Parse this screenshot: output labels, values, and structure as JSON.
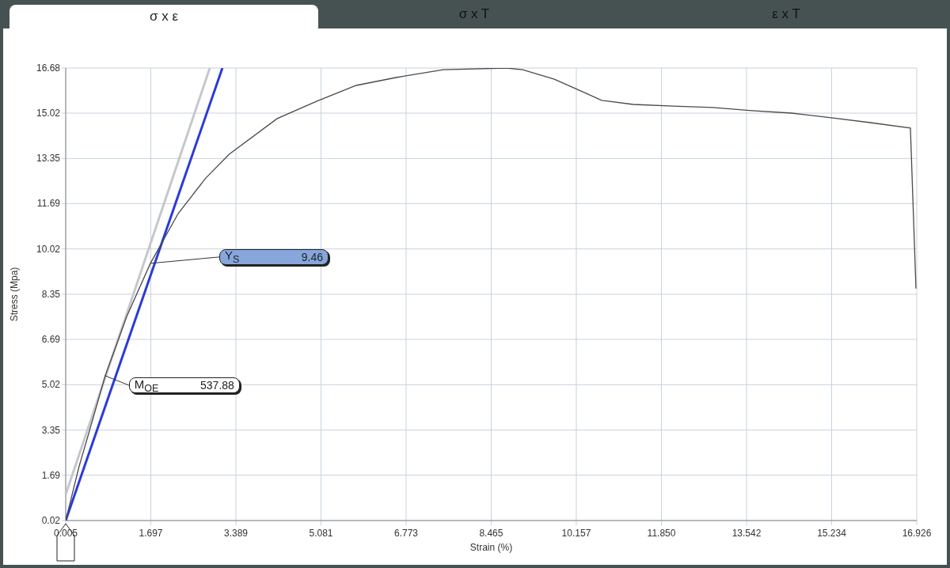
{
  "tabs": [
    {
      "label": "σ x ε",
      "selected": true
    },
    {
      "label": "σ x T",
      "selected": false
    },
    {
      "label": "ε x T",
      "selected": false
    }
  ],
  "chart": {
    "chart_data": {
      "type": "line",
      "xlabel": "Strain (%)",
      "ylabel": "Stress (Mpa)",
      "xlim": [
        0.005,
        16.926
      ],
      "ylim": [
        0.02,
        16.68
      ],
      "xticks": [
        0.005,
        1.697,
        3.389,
        5.081,
        6.773,
        8.465,
        10.157,
        {
          "value": 11.85,
          "label": "11.850"
        },
        13.542,
        15.234,
        16.926
      ],
      "yticks": [
        0.02,
        1.69,
        3.35,
        5.02,
        6.69,
        8.35,
        10.02,
        11.69,
        13.35,
        15.02,
        16.68
      ],
      "series": [
        {
          "color": "#c4c8cc",
          "x": [
            0.005,
            2.87
          ],
          "values": [
            0.98,
            16.68
          ]
        },
        {
          "color": "#2a3bd8",
          "x": [
            0.005,
            3.12
          ],
          "values": [
            0.02,
            16.68
          ]
        },
        {
          "color": "#4a4a4a",
          "x": [
            0.005,
            0.27,
            0.43,
            0.79,
            1.22,
            1.69,
            2.24,
            2.79,
            3.26,
            4.21,
            5.0,
            5.78,
            6.57,
            7.51,
            8.77,
            9.09,
            9.72,
            10.35,
            10.66,
            11.29,
            12.08,
            12.87,
            13.65,
            14.44,
            15.23,
            16.0,
            16.8,
            16.91
          ],
          "values": [
            0.02,
            2.0,
            3.02,
            5.35,
            7.54,
            9.49,
            11.32,
            12.63,
            13.51,
            14.82,
            15.46,
            16.04,
            16.33,
            16.62,
            16.68,
            16.62,
            16.27,
            15.75,
            15.49,
            15.34,
            15.28,
            15.23,
            15.11,
            15.02,
            14.85,
            14.67,
            14.47,
            8.56
          ]
        }
      ],
      "grid": true
    },
    "callouts": [
      {
        "label": "Y$_{S}$",
        "value": "9.46",
        "color": "#86a6dc"
      },
      {
        "label": "M$_{OE}$",
        "value": "537.88",
        "color": "#ffffff"
      }
    ]
  }
}
